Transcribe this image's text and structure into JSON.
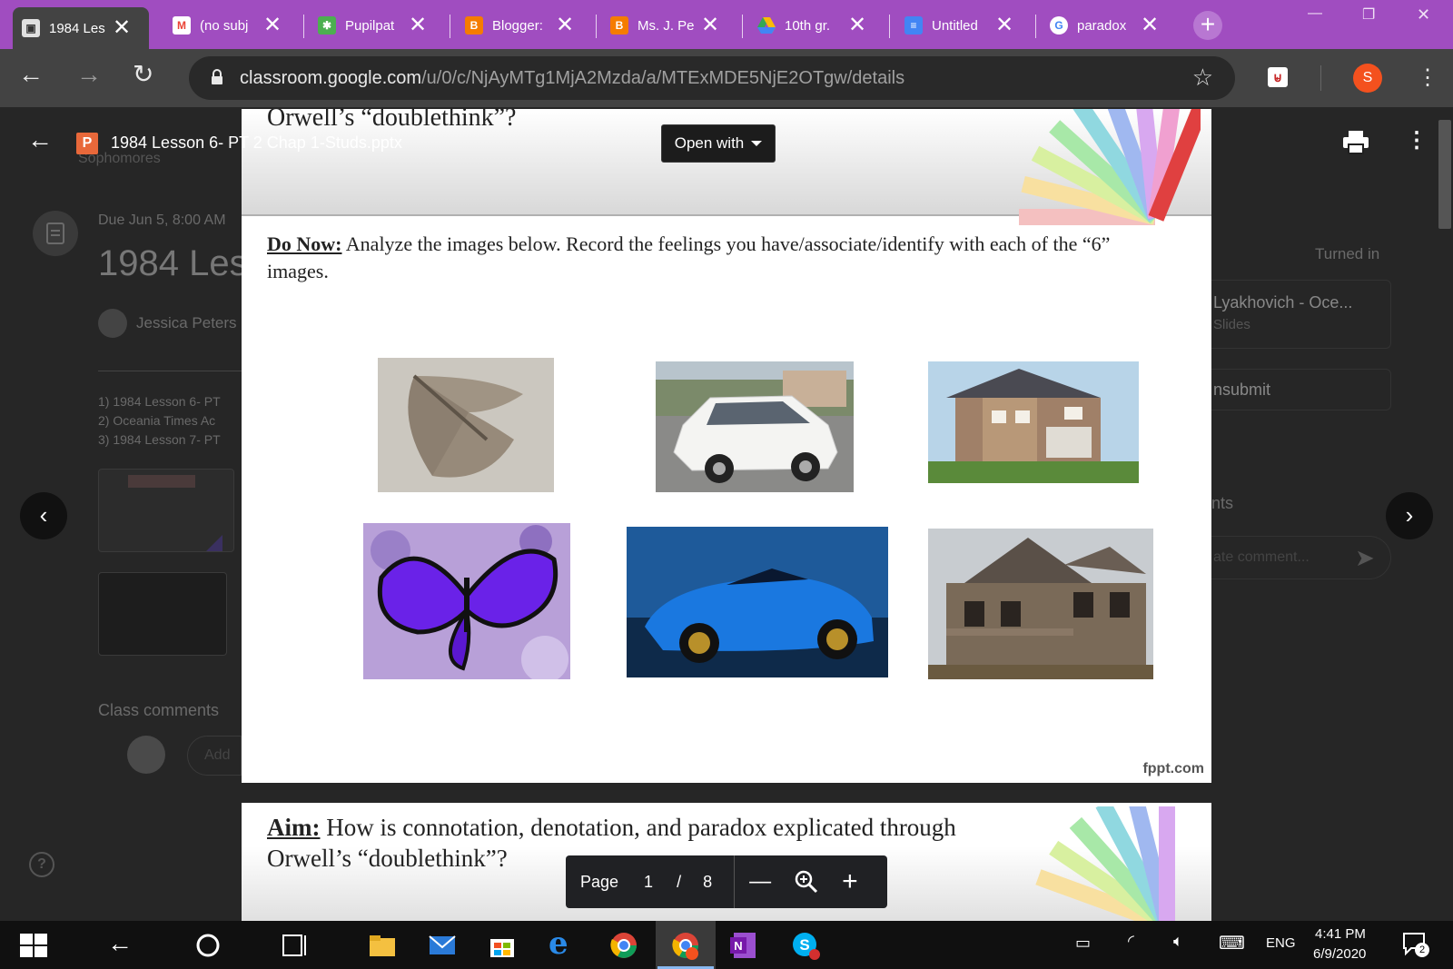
{
  "browser": {
    "tabs": [
      {
        "title": "1984 Les",
        "icon": "classroom-icon",
        "color": "#333333"
      },
      {
        "title": "(no subj",
        "icon": "gmail-icon",
        "color": "#ea4335"
      },
      {
        "title": "Pupilpat",
        "icon": "pupilpath-icon",
        "color": "#4caf50"
      },
      {
        "title": "Blogger:",
        "icon": "blogger-icon",
        "color": "#f57c00"
      },
      {
        "title": "Ms. J. Pe",
        "icon": "blogger-icon",
        "color": "#f57c00"
      },
      {
        "title": "10th gr.",
        "icon": "drive-icon",
        "color": "#fbbc04"
      },
      {
        "title": "Untitled",
        "icon": "docs-icon",
        "color": "#4285f4"
      },
      {
        "title": "paradox",
        "icon": "google-icon",
        "color": "#ffffff"
      }
    ],
    "url_host": "classroom.google.com",
    "url_path": "/u/0/c/NjAyMTg1MjA2Mzda/a/MTExMDE5NjE2OTgw/details",
    "profile_initial": "S"
  },
  "viewer": {
    "file_badge": "P",
    "file_name": "1984 Lesson 6- PT 2 Chap 1-Studs.pptx",
    "open_with": "Open with"
  },
  "classroom": {
    "class_name": "Sophomores",
    "due": "Due Jun 5, 8:00 AM",
    "title": "1984 Les",
    "teacher": "Jessica Peters",
    "attachments": [
      "1) 1984 Lesson 6- PT",
      "2) Oceania Times Ac",
      "3) 1984 Lesson 7- PT"
    ],
    "class_comments": "Class comments",
    "add_comment_placeholder": "Add",
    "turned_in": "Turned in",
    "student_work": "Lyakhovich - Oce...",
    "student_work_type": "Slides",
    "unsubmit": "nsubmit",
    "private_comments": "nts",
    "private_comment_placeholder": "ate comment..."
  },
  "slide1": {
    "top_fragment": "Orwell’s “doublethink”?",
    "do_now_label": "Do Now:",
    "do_now_text": " Analyze the images below.  Record the feelings you have/associate/identify with each of the “6” images.",
    "footer": "fppt.com"
  },
  "slide2": {
    "aim_label": "Aim:",
    "aim_text": " How is connotation, denotation, and paradox explicated through",
    "aim_text2": "Orwell’s “doublethink”?"
  },
  "pager": {
    "label": "Page",
    "current": "1",
    "slash": "/",
    "total": "8"
  },
  "taskbar": {
    "language": "ENG",
    "time": "4:41 PM",
    "date": "6/9/2020",
    "notifications": "2"
  }
}
